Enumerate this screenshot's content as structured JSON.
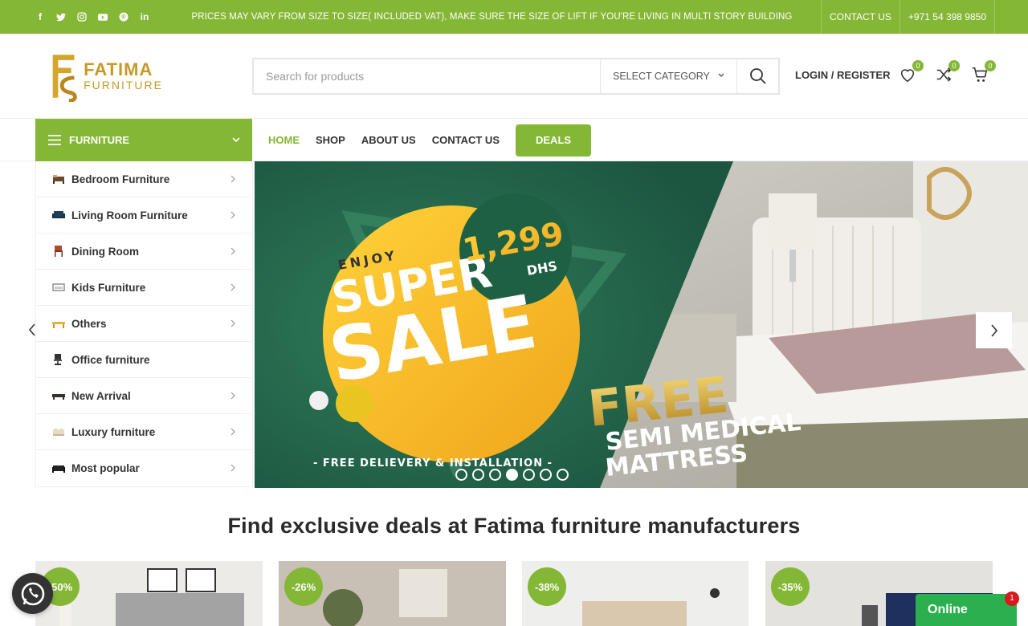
{
  "topbar": {
    "social": [
      {
        "name": "facebook-icon",
        "glyph": "f"
      },
      {
        "name": "twitter-icon",
        "glyph": "t"
      },
      {
        "name": "instagram-icon",
        "glyph": "◎"
      },
      {
        "name": "youtube-icon",
        "glyph": "▶"
      },
      {
        "name": "pinterest-icon",
        "glyph": "p"
      },
      {
        "name": "linkedin-icon",
        "glyph": "in"
      }
    ],
    "notice": "PRICES MAY VARY FROM SIZE TO SIZE( INCLUDED VAT), MAKE SURE THE SIZE OF LIFT IF YOU'RE LIVING IN MULTI STORY BUILDING",
    "contact_link": "CONTACT US",
    "phone": "+971 54 398 9850",
    "accent": "#83b735"
  },
  "header": {
    "logo_title": "FATIMA",
    "logo_subtitle": "FURNITURE",
    "search_placeholder": "Search for products",
    "category_select": "SELECT CATEGORY",
    "login": "LOGIN / REGISTER",
    "wishlist_count": "0",
    "compare_count": "0",
    "cart_count": "0"
  },
  "nav": {
    "category_button": "FURNITURE",
    "links": [
      "HOME",
      "SHOP",
      "ABOUT US",
      "CONTACT US"
    ],
    "deals": "DEALS"
  },
  "categories": [
    {
      "label": "Bedroom Furniture",
      "has_arrow": true
    },
    {
      "label": "Living Room Furniture",
      "has_arrow": true
    },
    {
      "label": "Dining Room",
      "has_arrow": true
    },
    {
      "label": "Kids Furniture",
      "has_arrow": true
    },
    {
      "label": "Others",
      "has_arrow": true
    },
    {
      "label": "Office furniture",
      "has_arrow": false
    },
    {
      "label": "New Arrival",
      "has_arrow": true
    },
    {
      "label": "Luxury furniture",
      "has_arrow": true
    },
    {
      "label": "Most popular",
      "has_arrow": true
    }
  ],
  "slider": {
    "enjoy": "ENJOY",
    "super": "SUPER",
    "sale": "SALE",
    "price": "1,299",
    "currency": "DHS",
    "free": "FREE",
    "offer_line1": "SEMI MEDICAL",
    "offer_line2": "MATTRESS",
    "footer": "- FREE DELIEVERY & INSTALLATION -",
    "dot_count": 7,
    "active_dot": 4
  },
  "section": {
    "title": "Find exclusive deals at Fatima furniture manufacturers"
  },
  "products": [
    {
      "discount": "-50%"
    },
    {
      "discount": "-26%"
    },
    {
      "discount": "-38%"
    },
    {
      "discount": "-35%"
    }
  ],
  "chat": {
    "online": "Online",
    "unread": "1"
  }
}
